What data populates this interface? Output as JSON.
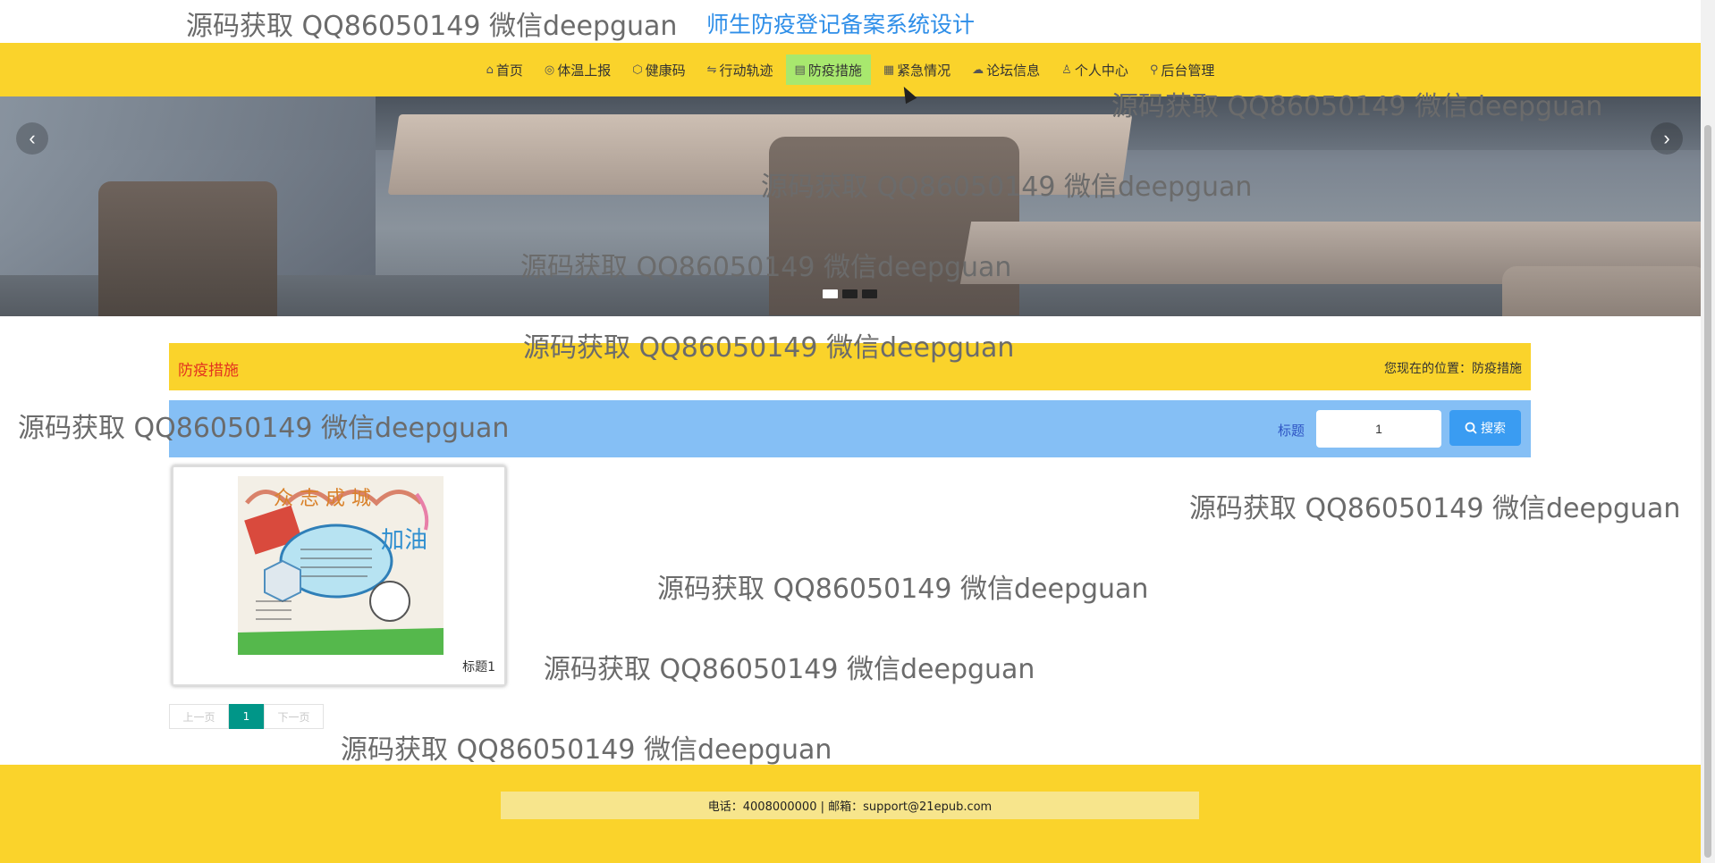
{
  "header": {
    "site_title": "师生防疫登记备案系统设计"
  },
  "nav": {
    "items": [
      {
        "label": "首页",
        "icon": "home-icon",
        "glyph": "⌂"
      },
      {
        "label": "体温上报",
        "icon": "globe-icon",
        "glyph": "◎"
      },
      {
        "label": "健康码",
        "icon": "cube-icon",
        "glyph": "⬡"
      },
      {
        "label": "行动轨迹",
        "icon": "sliders-icon",
        "glyph": "⇋"
      },
      {
        "label": "防疫措施",
        "icon": "clipboard-icon",
        "glyph": "▤"
      },
      {
        "label": "紧急情况",
        "icon": "grid-icon",
        "glyph": "▦"
      },
      {
        "label": "论坛信息",
        "icon": "cloud-icon",
        "glyph": "☁"
      },
      {
        "label": "个人中心",
        "icon": "user-icon",
        "glyph": "♙"
      },
      {
        "label": "后台管理",
        "icon": "link-icon",
        "glyph": "⚲"
      }
    ],
    "active_index": 4,
    "active_color": "#a8e86e"
  },
  "banner": {
    "prev_glyph": "‹",
    "next_glyph": "›",
    "slide_count": 3,
    "active_slide": 1
  },
  "breadcrumb": {
    "title": "防疫措施",
    "location_prefix": "您现在的位置：",
    "location_current": "防疫措施"
  },
  "search": {
    "label": "标题",
    "value": "1",
    "button_label": "搜索",
    "button_icon": "search-icon"
  },
  "cards": [
    {
      "caption": "标题1",
      "image": "防疫手抄报 众志成城 加油"
    }
  ],
  "pagination": {
    "prev_label": "上一页",
    "current": "1",
    "next_label": "下一页"
  },
  "footer": {
    "contact": "电话：4008000000 | 邮箱：support@21epub.com"
  },
  "watermark": {
    "text": "源码获取 QQ86050149 微信deepguan"
  },
  "colors": {
    "brand_yellow": "#fad32b",
    "search_blue": "#85bff5",
    "title_blue": "#2e8ee8",
    "pager_teal": "#009688"
  }
}
